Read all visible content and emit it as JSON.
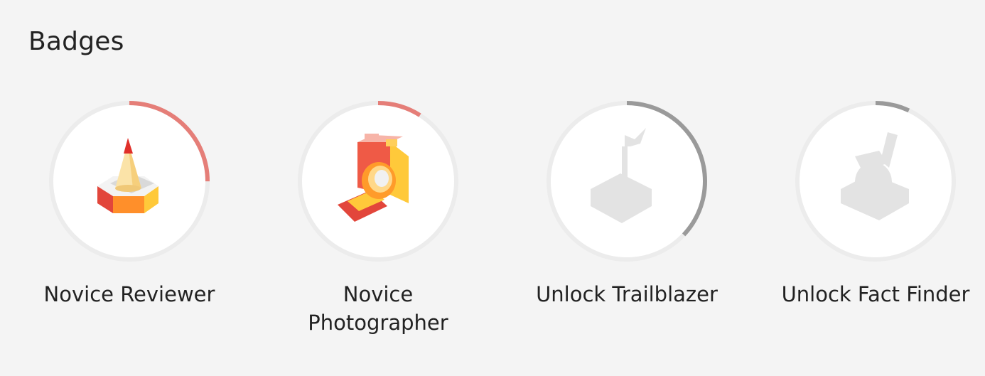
{
  "section": {
    "title": "Badges"
  },
  "colors": {
    "progress_earned": "#e57e78",
    "progress_locked": "#9a9a9a",
    "track": "#ececec",
    "circle_fill": "#ffffff",
    "locked_icon": "#e3e3e3"
  },
  "badges": [
    {
      "label": "Novice Reviewer",
      "icon": "traffic-cone-icon",
      "progress": 0.25,
      "state": "earned"
    },
    {
      "label": "Novice Photographer",
      "icon": "camera-icon",
      "progress": 0.09,
      "state": "earned"
    },
    {
      "label": "Unlock Trailblazer",
      "icon": "flag-on-platform-icon",
      "progress": 0.37,
      "state": "locked"
    },
    {
      "label": "Unlock Fact Finder",
      "icon": "magnifying-glass-icon",
      "progress": 0.07,
      "state": "locked"
    }
  ]
}
